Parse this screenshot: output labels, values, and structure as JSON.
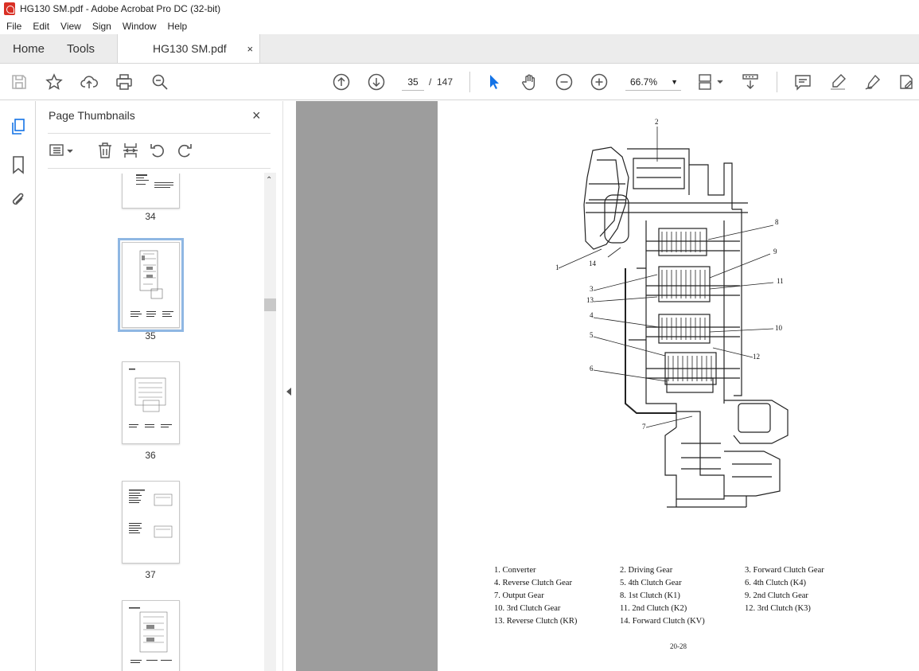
{
  "window": {
    "title": "HG130 SM.pdf - Adobe Acrobat Pro DC (32-bit)"
  },
  "menu": [
    "File",
    "Edit",
    "View",
    "Sign",
    "Window",
    "Help"
  ],
  "tabs": {
    "home": "Home",
    "tools": "Tools",
    "doc": "HG130 SM.pdf",
    "close": "×"
  },
  "toolbar": {
    "page_current": "35",
    "page_sep": "/",
    "page_total": "147",
    "zoom": "66.7%"
  },
  "panel": {
    "title": "Page Thumbnails",
    "close": "×",
    "thumbnails": [
      {
        "label": "34"
      },
      {
        "label": "35",
        "selected": true
      },
      {
        "label": "36"
      },
      {
        "label": "37"
      },
      {
        "label": ""
      }
    ]
  },
  "document": {
    "callouts": [
      "2",
      "8",
      "9",
      "11",
      "1",
      "14",
      "3",
      "13",
      "4",
      "10",
      "5",
      "12",
      "6",
      "7"
    ],
    "legend": [
      [
        "1. Converter",
        "2. Driving Gear",
        "3. Forward Clutch Gear"
      ],
      [
        "4. Reverse Clutch Gear",
        "5. 4th Clutch Gear",
        "6. 4th Clutch (K4)"
      ],
      [
        "7. Output Gear",
        "8. 1st Clutch (K1)",
        "9. 2nd Clutch Gear"
      ],
      [
        "10. 3rd Clutch Gear",
        "11. 2nd Clutch (K2)",
        "12. 3rd Clutch (K3)"
      ],
      [
        "13. Reverse Clutch (KR)",
        "14. Forward Clutch (KV)",
        ""
      ]
    ],
    "page_number": "20-28"
  },
  "colors": {
    "accent": "#1473e6",
    "selection": "#8fb7e3",
    "viewer_bg": "#9d9d9d",
    "pdf_icon": "#d93025"
  }
}
